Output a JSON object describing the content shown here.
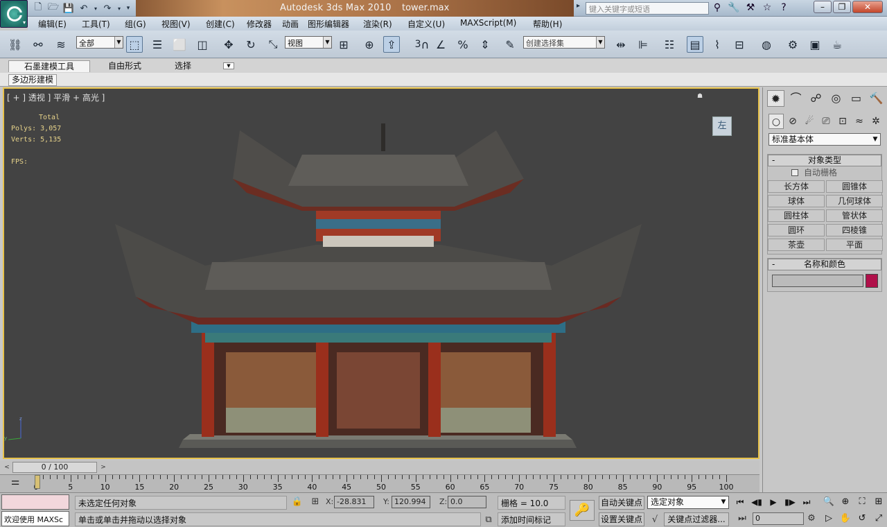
{
  "app": {
    "title": "Autodesk 3ds Max  2010",
    "file": "tower.max",
    "search_placeholder": "键入关键字或短语"
  },
  "menu": [
    "编辑(E)",
    "工具(T)",
    "组(G)",
    "视图(V)",
    "创建(C)",
    "修改器",
    "动画",
    "图形编辑器",
    "渲染(R)",
    "自定义(U)",
    "MAXScript(M)",
    "帮助(H)"
  ],
  "toolbar": {
    "selection_filter": "全部",
    "reference_coord": "视图",
    "named_selection": "创建选择集",
    "snap_label": "3"
  },
  "ribbon": {
    "tabs": [
      "石墨建模工具",
      "自由形式",
      "选择"
    ],
    "panel_tab": "多边形建模"
  },
  "viewport": {
    "label": "[ + ] 透视 ] 平滑 + 高光 ]",
    "stats_header": "Total",
    "polys_label": "Polys:",
    "polys": "3,057",
    "verts_label": "Verts:",
    "verts": "5,135",
    "fps_label": "FPS:",
    "viewcube_label": "左"
  },
  "scroll": {
    "frame_range": "0 / 100"
  },
  "timeline": {
    "ticks": [
      "0",
      "5",
      "10",
      "15",
      "20",
      "25",
      "30",
      "35",
      "40",
      "45",
      "50",
      "55",
      "60",
      "65",
      "70",
      "75",
      "80",
      "85",
      "90",
      "95",
      "100"
    ]
  },
  "command_panel": {
    "category": "标准基本体",
    "object_type_title": "对象类型",
    "autogrid": "自动栅格",
    "objects": [
      "长方体",
      "圆锥体",
      "球体",
      "几何球体",
      "圆柱体",
      "管状体",
      "圆环",
      "四棱锥",
      "茶壶",
      "平面"
    ],
    "name_color_title": "名称和颜色",
    "object_color": "#b0104a"
  },
  "status": {
    "maxscript": "欢迎使用 MAXSc",
    "line1": "未选定任何对象",
    "line2": "单击或单击并拖动以选择对象",
    "x_label": "X:",
    "x": "-28.831",
    "y_label": "Y:",
    "y": "120.994",
    "z_label": "Z:",
    "z": "0.0",
    "grid": "栅格 = 10.0",
    "add_time_tag": "添加时间标记",
    "auto_key": "自动关键点",
    "set_key": "设置关键点",
    "selection_mode": "选定对象",
    "key_filters": "关键点过滤器...",
    "current_frame": "0"
  }
}
